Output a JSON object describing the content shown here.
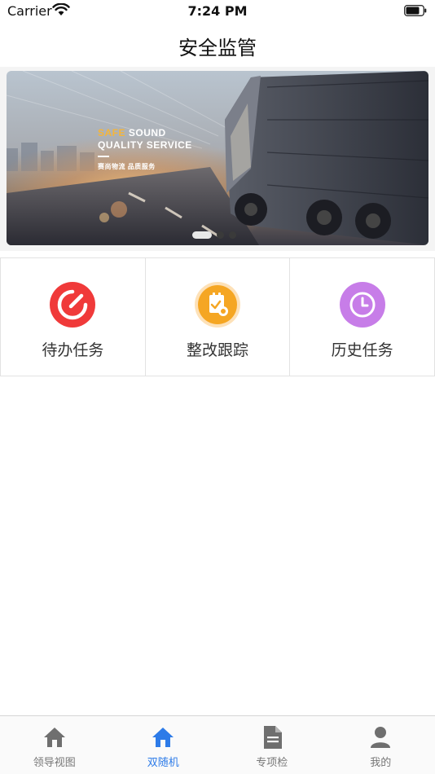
{
  "status_bar": {
    "carrier": "Carrier",
    "time": "7:24 PM"
  },
  "header": {
    "title": "安全监管"
  },
  "banner": {
    "slogan_accent": "SAFE",
    "slogan_line1_rest": " SOUND",
    "slogan_line2": "QUALITY SERVICE",
    "slogan_line3": "赛尚物流  品质服务",
    "carousel": {
      "page_count": 3,
      "active_index": 0
    }
  },
  "quick_actions": [
    {
      "label": "待办任务",
      "icon": "gauge-icon",
      "color": "#f03a3a"
    },
    {
      "label": "整改跟踪",
      "icon": "clipboard-check-icon",
      "color": "#f5a623"
    },
    {
      "label": "历史任务",
      "icon": "clock-icon",
      "color": "#c77de8"
    }
  ],
  "tab_bar": {
    "active_index": 1,
    "active_color": "#2d7be8",
    "inactive_color": "#6f6f6f",
    "items": [
      {
        "label": "领导视图",
        "icon": "home-icon"
      },
      {
        "label": "双随机",
        "icon": "home-icon"
      },
      {
        "label": "专项检",
        "icon": "document-icon"
      },
      {
        "label": "我的",
        "icon": "person-icon"
      }
    ]
  }
}
